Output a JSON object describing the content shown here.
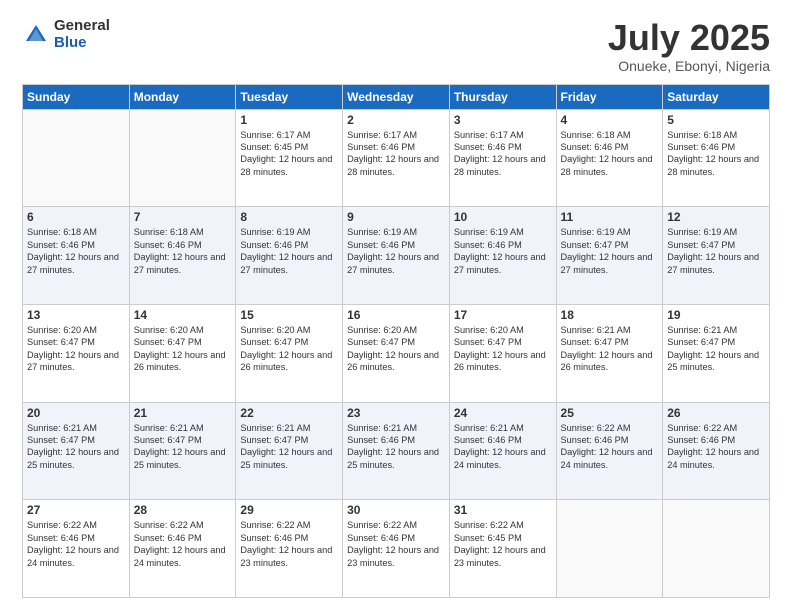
{
  "header": {
    "logo_general": "General",
    "logo_blue": "Blue",
    "title": "July 2025",
    "subtitle": "Onueke, Ebonyi, Nigeria"
  },
  "days_of_week": [
    "Sunday",
    "Monday",
    "Tuesday",
    "Wednesday",
    "Thursday",
    "Friday",
    "Saturday"
  ],
  "weeks": [
    [
      {
        "day": "",
        "info": ""
      },
      {
        "day": "",
        "info": ""
      },
      {
        "day": "1",
        "info": "Sunrise: 6:17 AM\nSunset: 6:45 PM\nDaylight: 12 hours and 28 minutes."
      },
      {
        "day": "2",
        "info": "Sunrise: 6:17 AM\nSunset: 6:46 PM\nDaylight: 12 hours and 28 minutes."
      },
      {
        "day": "3",
        "info": "Sunrise: 6:17 AM\nSunset: 6:46 PM\nDaylight: 12 hours and 28 minutes."
      },
      {
        "day": "4",
        "info": "Sunrise: 6:18 AM\nSunset: 6:46 PM\nDaylight: 12 hours and 28 minutes."
      },
      {
        "day": "5",
        "info": "Sunrise: 6:18 AM\nSunset: 6:46 PM\nDaylight: 12 hours and 28 minutes."
      }
    ],
    [
      {
        "day": "6",
        "info": "Sunrise: 6:18 AM\nSunset: 6:46 PM\nDaylight: 12 hours and 27 minutes."
      },
      {
        "day": "7",
        "info": "Sunrise: 6:18 AM\nSunset: 6:46 PM\nDaylight: 12 hours and 27 minutes."
      },
      {
        "day": "8",
        "info": "Sunrise: 6:19 AM\nSunset: 6:46 PM\nDaylight: 12 hours and 27 minutes."
      },
      {
        "day": "9",
        "info": "Sunrise: 6:19 AM\nSunset: 6:46 PM\nDaylight: 12 hours and 27 minutes."
      },
      {
        "day": "10",
        "info": "Sunrise: 6:19 AM\nSunset: 6:46 PM\nDaylight: 12 hours and 27 minutes."
      },
      {
        "day": "11",
        "info": "Sunrise: 6:19 AM\nSunset: 6:47 PM\nDaylight: 12 hours and 27 minutes."
      },
      {
        "day": "12",
        "info": "Sunrise: 6:19 AM\nSunset: 6:47 PM\nDaylight: 12 hours and 27 minutes."
      }
    ],
    [
      {
        "day": "13",
        "info": "Sunrise: 6:20 AM\nSunset: 6:47 PM\nDaylight: 12 hours and 27 minutes."
      },
      {
        "day": "14",
        "info": "Sunrise: 6:20 AM\nSunset: 6:47 PM\nDaylight: 12 hours and 26 minutes."
      },
      {
        "day": "15",
        "info": "Sunrise: 6:20 AM\nSunset: 6:47 PM\nDaylight: 12 hours and 26 minutes."
      },
      {
        "day": "16",
        "info": "Sunrise: 6:20 AM\nSunset: 6:47 PM\nDaylight: 12 hours and 26 minutes."
      },
      {
        "day": "17",
        "info": "Sunrise: 6:20 AM\nSunset: 6:47 PM\nDaylight: 12 hours and 26 minutes."
      },
      {
        "day": "18",
        "info": "Sunrise: 6:21 AM\nSunset: 6:47 PM\nDaylight: 12 hours and 26 minutes."
      },
      {
        "day": "19",
        "info": "Sunrise: 6:21 AM\nSunset: 6:47 PM\nDaylight: 12 hours and 25 minutes."
      }
    ],
    [
      {
        "day": "20",
        "info": "Sunrise: 6:21 AM\nSunset: 6:47 PM\nDaylight: 12 hours and 25 minutes."
      },
      {
        "day": "21",
        "info": "Sunrise: 6:21 AM\nSunset: 6:47 PM\nDaylight: 12 hours and 25 minutes."
      },
      {
        "day": "22",
        "info": "Sunrise: 6:21 AM\nSunset: 6:47 PM\nDaylight: 12 hours and 25 minutes."
      },
      {
        "day": "23",
        "info": "Sunrise: 6:21 AM\nSunset: 6:46 PM\nDaylight: 12 hours and 25 minutes."
      },
      {
        "day": "24",
        "info": "Sunrise: 6:21 AM\nSunset: 6:46 PM\nDaylight: 12 hours and 24 minutes."
      },
      {
        "day": "25",
        "info": "Sunrise: 6:22 AM\nSunset: 6:46 PM\nDaylight: 12 hours and 24 minutes."
      },
      {
        "day": "26",
        "info": "Sunrise: 6:22 AM\nSunset: 6:46 PM\nDaylight: 12 hours and 24 minutes."
      }
    ],
    [
      {
        "day": "27",
        "info": "Sunrise: 6:22 AM\nSunset: 6:46 PM\nDaylight: 12 hours and 24 minutes."
      },
      {
        "day": "28",
        "info": "Sunrise: 6:22 AM\nSunset: 6:46 PM\nDaylight: 12 hours and 24 minutes."
      },
      {
        "day": "29",
        "info": "Sunrise: 6:22 AM\nSunset: 6:46 PM\nDaylight: 12 hours and 23 minutes."
      },
      {
        "day": "30",
        "info": "Sunrise: 6:22 AM\nSunset: 6:46 PM\nDaylight: 12 hours and 23 minutes."
      },
      {
        "day": "31",
        "info": "Sunrise: 6:22 AM\nSunset: 6:45 PM\nDaylight: 12 hours and 23 minutes."
      },
      {
        "day": "",
        "info": ""
      },
      {
        "day": "",
        "info": ""
      }
    ]
  ]
}
